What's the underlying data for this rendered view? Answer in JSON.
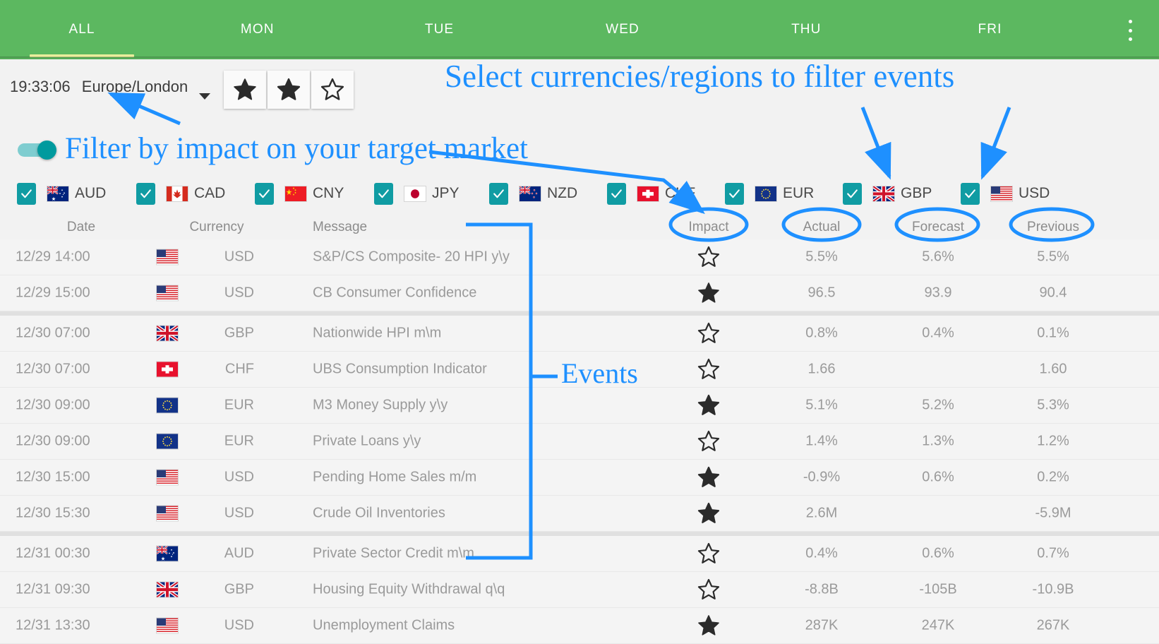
{
  "tabs": [
    {
      "label": "ALL",
      "active": true
    },
    {
      "label": "MON",
      "active": false
    },
    {
      "label": "TUE",
      "active": false
    },
    {
      "label": "WED",
      "active": false
    },
    {
      "label": "THU",
      "active": false
    },
    {
      "label": "FRI",
      "active": false
    }
  ],
  "overflow_menu": "more-options",
  "toolbar": {
    "time": "19:33:06",
    "timezone": "Europe/London",
    "star_filters": [
      {
        "name": "high-impact",
        "state": "full"
      },
      {
        "name": "medium-impact",
        "state": "half"
      },
      {
        "name": "low-impact",
        "state": "empty"
      }
    ]
  },
  "impact_toggle": {
    "on": true
  },
  "currencies": [
    {
      "code": "AUD",
      "checked": true,
      "flag": "au"
    },
    {
      "code": "CAD",
      "checked": true,
      "flag": "ca"
    },
    {
      "code": "CNY",
      "checked": true,
      "flag": "cn"
    },
    {
      "code": "JPY",
      "checked": true,
      "flag": "jp"
    },
    {
      "code": "NZD",
      "checked": true,
      "flag": "nz"
    },
    {
      "code": "CHF",
      "checked": true,
      "flag": "ch"
    },
    {
      "code": "EUR",
      "checked": true,
      "flag": "eu"
    },
    {
      "code": "GBP",
      "checked": true,
      "flag": "gb"
    },
    {
      "code": "USD",
      "checked": true,
      "flag": "us"
    }
  ],
  "table": {
    "headers": {
      "date": "Date",
      "currency": "Currency",
      "message": "Message",
      "impact": "Impact",
      "actual": "Actual",
      "forecast": "Forecast",
      "previous": "Previous"
    },
    "rows": [
      {
        "date": "12/29 14:00",
        "flag": "us",
        "currency": "USD",
        "message": "S&P/CS Composite- 20 HPI y\\y",
        "impact": "empty",
        "actual": "5.5%",
        "forecast": "5.6%",
        "previous": "5.5%",
        "group_start": true
      },
      {
        "date": "12/29 15:00",
        "flag": "us",
        "currency": "USD",
        "message": "CB Consumer Confidence",
        "impact": "full",
        "actual": "96.5",
        "forecast": "93.9",
        "previous": "90.4",
        "group_start": false
      },
      {
        "date": "12/30 07:00",
        "flag": "gb",
        "currency": "GBP",
        "message": "Nationwide HPI m\\m",
        "impact": "empty",
        "actual": "0.8%",
        "forecast": "0.4%",
        "previous": "0.1%",
        "group_start": true
      },
      {
        "date": "12/30 07:00",
        "flag": "ch",
        "currency": "CHF",
        "message": "UBS Consumption Indicator",
        "impact": "empty",
        "actual": "1.66",
        "forecast": "",
        "previous": "1.60",
        "group_start": false
      },
      {
        "date": "12/30 09:00",
        "flag": "eu",
        "currency": "EUR",
        "message": "M3 Money Supply y\\y",
        "impact": "half",
        "actual": "5.1%",
        "forecast": "5.2%",
        "previous": "5.3%",
        "group_start": false
      },
      {
        "date": "12/30 09:00",
        "flag": "eu",
        "currency": "EUR",
        "message": "Private Loans y\\y",
        "impact": "empty",
        "actual": "1.4%",
        "forecast": "1.3%",
        "previous": "1.2%",
        "group_start": false
      },
      {
        "date": "12/30 15:00",
        "flag": "us",
        "currency": "USD",
        "message": "Pending Home Sales m/m",
        "impact": "half",
        "actual": "-0.9%",
        "forecast": "0.6%",
        "previous": "0.2%",
        "group_start": false
      },
      {
        "date": "12/30 15:30",
        "flag": "us",
        "currency": "USD",
        "message": "Crude Oil Inventories",
        "impact": "half",
        "actual": "2.6M",
        "forecast": "",
        "previous": "-5.9M",
        "group_start": false
      },
      {
        "date": "12/31 00:30",
        "flag": "au",
        "currency": "AUD",
        "message": "Private Sector Credit m\\m",
        "impact": "empty",
        "actual": "0.4%",
        "forecast": "0.6%",
        "previous": "0.7%",
        "group_start": true
      },
      {
        "date": "12/31 09:30",
        "flag": "gb",
        "currency": "GBP",
        "message": "Housing Equity Withdrawal q\\q",
        "impact": "empty",
        "actual": "-8.8B",
        "forecast": "-105B",
        "previous": "-10.9B",
        "group_start": false
      },
      {
        "date": "12/31 13:30",
        "flag": "us",
        "currency": "USD",
        "message": "Unemployment Claims",
        "impact": "full",
        "actual": "287K",
        "forecast": "247K",
        "previous": "267K",
        "group_start": false
      }
    ]
  },
  "annotations": {
    "currencies": "Select currencies/regions to filter events",
    "impact": "Filter by impact on your target market",
    "events": "Events",
    "color": "#1e90ff"
  }
}
